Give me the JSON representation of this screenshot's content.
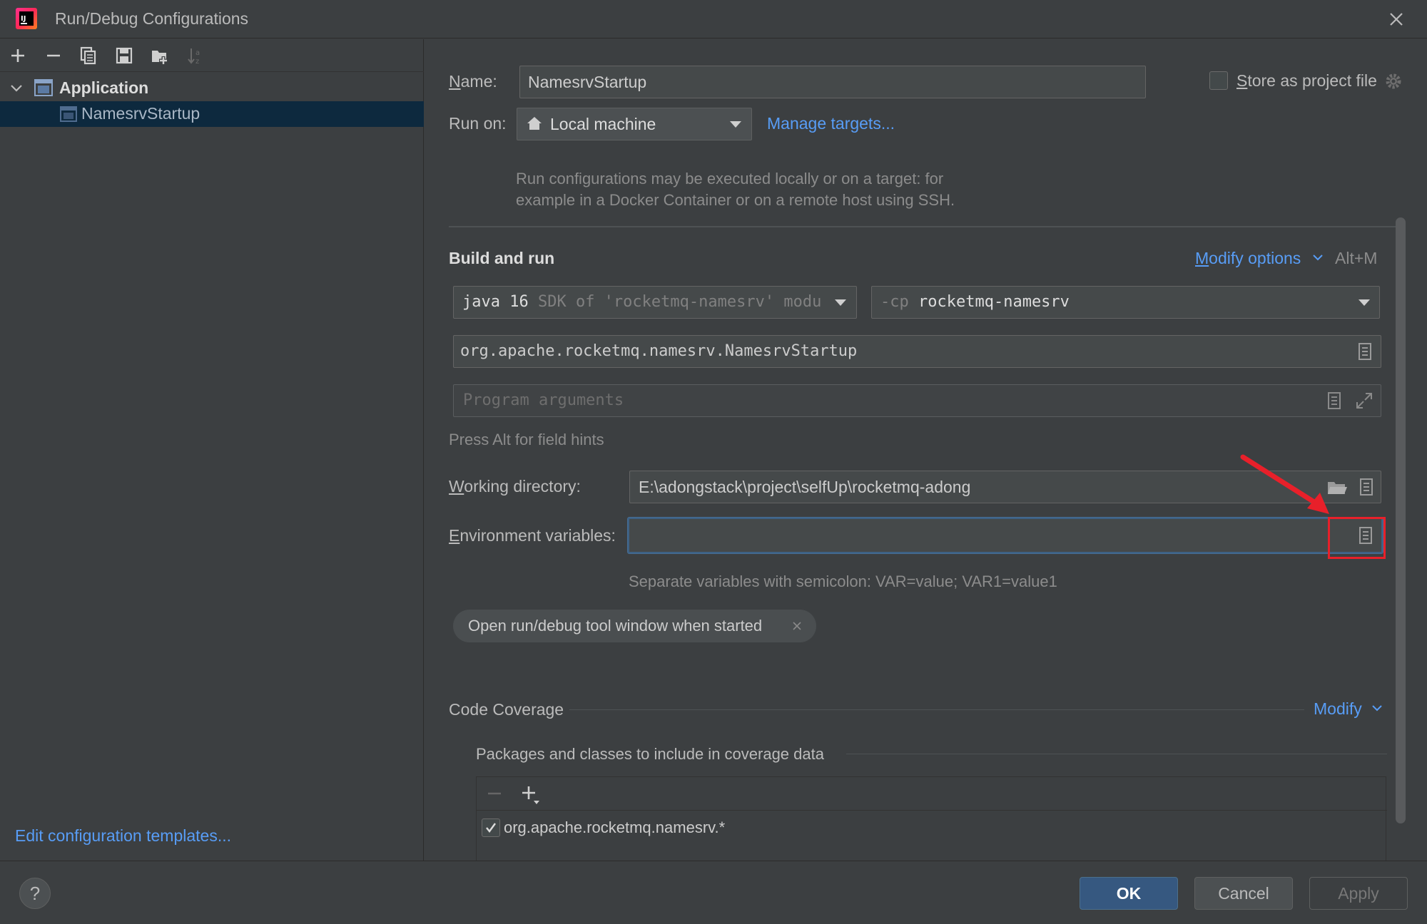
{
  "window": {
    "title": "Run/Debug Configurations"
  },
  "tree": {
    "group_label": "Application",
    "item_label": "NamesrvStartup"
  },
  "left": {
    "edit_templates": "Edit configuration templates..."
  },
  "form": {
    "name_label_u": "N",
    "name_label_rest": "ame:",
    "name_value": "NamesrvStartup",
    "store_label_u": "S",
    "store_label_rest": "tore as project file",
    "run_on_label": "Run on:",
    "run_on_value": "Local machine",
    "manage_targets": "Manage targets...",
    "run_hint_1": "Run configurations may be executed locally or on a target: for",
    "run_hint_2": "example in a Docker Container or on a remote host using SSH.",
    "build_and_run": "Build and run",
    "modify_options_u": "M",
    "modify_options_rest": "odify options",
    "modify_shortcut": "Alt+M",
    "jdk_main": "java 16",
    "jdk_hint": "SDK of 'rocketmq-namesrv' modu",
    "cp_prefix": "-cp",
    "cp_value": "rocketmq-namesrv",
    "main_class": "org.apache.rocketmq.namesrv.NamesrvStartup",
    "program_args_placeholder": "Program arguments",
    "field_hints": "Press Alt for field hints",
    "working_dir_label_u": "W",
    "working_dir_label_rest": "orking directory:",
    "working_dir_value": "E:\\adongstack\\project\\selfUp\\rocketmq-adong",
    "env_label_u": "E",
    "env_label_rest": "nvironment variables:",
    "env_value": "",
    "env_hint": "Separate variables with semicolon: VAR=value; VAR1=value1",
    "tag_open_tool_window": "Open run/debug tool window when started",
    "code_coverage": "Code Coverage",
    "modify": "Modify",
    "packages_label": "Packages and classes to include in coverage data",
    "coverage_item": "org.apache.rocketmq.namesrv.*",
    "coverage_item_checked": true
  },
  "buttons": {
    "ok": "OK",
    "cancel": "Cancel",
    "apply": "Apply",
    "help": "?"
  },
  "colors": {
    "background": "#3c3f41",
    "field": "#45494a",
    "selection": "#0d293e",
    "link": "#589df6",
    "ok_button": "#365880",
    "annotation_red": "#e8202a"
  }
}
